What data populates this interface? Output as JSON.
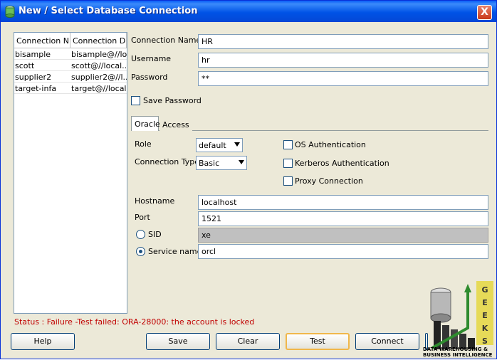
{
  "window": {
    "title": "New / Select Database Connection",
    "close_label": "X"
  },
  "connections": {
    "columns": [
      "Connection N...",
      "Connection D..."
    ],
    "rows": [
      [
        "bisample",
        "bisample@//lo..."
      ],
      [
        "scott",
        "scott@//local..."
      ],
      [
        "supplier2",
        "supplier2@//l..."
      ],
      [
        "target-infa",
        "target@//local..."
      ]
    ]
  },
  "form": {
    "connection_name_label": "Connection Name",
    "connection_name_value": "HR",
    "username_label": "Username",
    "username_value": "hr",
    "password_label": "Password",
    "password_value": "**",
    "save_password_label": "Save Password"
  },
  "tabs": {
    "oracle": "Oracle",
    "access": "Access"
  },
  "oracle": {
    "role_label": "Role",
    "role_value": "default",
    "conn_type_label": "Connection Type",
    "conn_type_value": "Basic",
    "os_auth_label": "OS Authentication",
    "kerberos_label": "Kerberos Authentication",
    "proxy_label": "Proxy Connection",
    "hostname_label": "Hostname",
    "hostname_value": "localhost",
    "port_label": "Port",
    "port_value": "1521",
    "sid_label": "SID",
    "sid_value": "xe",
    "service_label": "Service name",
    "service_value": "orcl"
  },
  "status": "Status : Failure -Test failed: ORA-28000: the account is locked",
  "buttons": {
    "help": "Help",
    "save": "Save",
    "clear": "Clear",
    "test": "Test",
    "connect": "Connect"
  },
  "logo": {
    "letters": "GEEKS",
    "caption": "DATA WAREHOUSING & BUSINESS INTELLIGENCE"
  }
}
